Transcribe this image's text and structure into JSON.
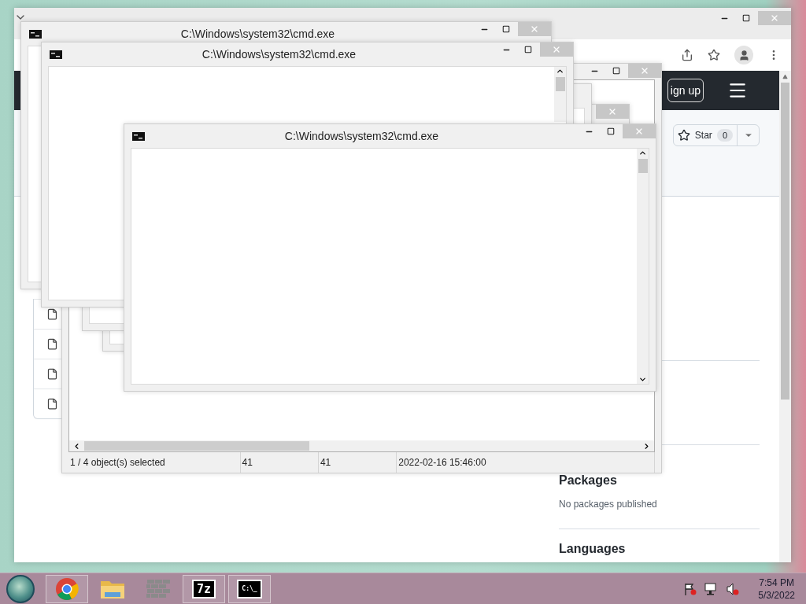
{
  "browser": {
    "header": {
      "signup_button": "ign up"
    },
    "star_button": {
      "label": "Star",
      "count": "0"
    },
    "file_items": [
      {
        "kind": "file"
      },
      {
        "kind": "file"
      },
      {
        "kind": "file"
      },
      {
        "kind": "file"
      }
    ],
    "sidebar": [
      {
        "heading": "Packages",
        "text": "No packages published"
      },
      {
        "heading": "Languages"
      }
    ]
  },
  "archive_window": {
    "status_bar": [
      "1 / 4 object(s) selected",
      "41",
      "41",
      "2022-02-16 15:46:00"
    ]
  },
  "cmd_windows": [
    {
      "title": "C:\\Windows\\system32\\cmd.exe"
    },
    {
      "title": "C:\\Windows\\system32\\cmd.exe"
    },
    {
      "title": "C:\\Windows\\system32\\cmd.exe"
    }
  ],
  "taskbar": {
    "apps": [
      {
        "kind": "start",
        "open": false
      },
      {
        "kind": "chrome",
        "open": true
      },
      {
        "kind": "explorer",
        "open": false
      },
      {
        "kind": "firewall",
        "open": false
      },
      {
        "kind": "archiver",
        "open": true,
        "label": "7z"
      },
      {
        "kind": "terminal",
        "open": true,
        "label": "C:\\_"
      }
    ],
    "clock": {
      "time": "7:54 PM",
      "date": "5/3/2022"
    }
  }
}
